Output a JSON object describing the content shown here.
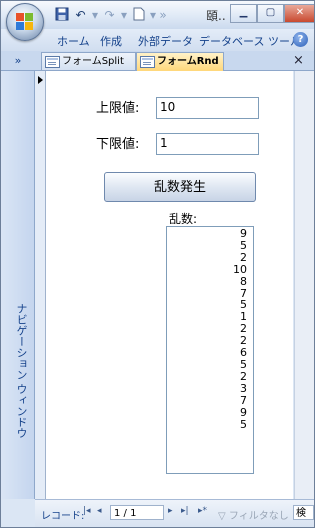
{
  "window": {
    "title": "頤..",
    "minimize_icon": "minimize-icon",
    "maximize_icon": "maximize-icon",
    "close_icon": "close-icon"
  },
  "quick_access": {
    "save_icon": "save-icon",
    "undo_icon": "undo-icon",
    "redo_icon": "redo-icon",
    "more_icon": "customize-icon"
  },
  "ribbon": {
    "tabs": [
      {
        "label": "ホーム"
      },
      {
        "label": "作成"
      },
      {
        "label": "外部データ"
      },
      {
        "label": "データベース ツール"
      }
    ],
    "help": "?"
  },
  "document_tabs": {
    "nav_toggle": "»",
    "tabs": [
      {
        "label": "フォームSplit",
        "active": false
      },
      {
        "label": "フォームRnd",
        "active": true
      }
    ],
    "close": "×"
  },
  "nav_pane": {
    "label": "ナビゲーション ウィンドウ"
  },
  "form": {
    "upper_label": "上限値:",
    "upper_value": "10",
    "lower_label": "下限値:",
    "lower_value": "1",
    "generate_button": "乱数発生",
    "random_label": "乱数:",
    "random_numbers": [
      "9",
      "5",
      "2",
      "10",
      "8",
      "7",
      "5",
      "1",
      "2",
      "2",
      "6",
      "5",
      "2",
      "3",
      "7",
      "9",
      "5"
    ]
  },
  "status_bar": {
    "record_label": "レコード:",
    "record_value": "1 / 1",
    "filter_label": "フィルタなし",
    "search_label": "検索"
  },
  "colors": {
    "accent": "#15428b",
    "active_tab": "#ffd77a"
  }
}
